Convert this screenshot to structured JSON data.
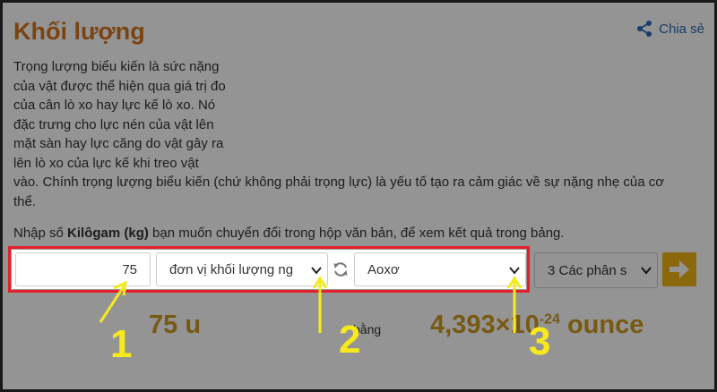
{
  "page": {
    "title": "Khối lượng",
    "share_label": "Chia sẻ",
    "description_lines": [
      "Trọng lượng biểu kiến là sức nặng",
      "của vật được thể hiện qua giá trị đo",
      "của cân lò xo hay lực kế lò xo. Nó",
      "đặc trưng cho lực nén của vật lên",
      "mặt sàn hay lực căng do vật gây ra",
      "lên lò xo của lực kế khi treo vật"
    ],
    "description_tail": "vào. Chính trọng lượng biểu kiến (chứ không phải trọng lực) là yếu tố tạo ra cảm giác về sự nặng nhẹ của cơ thể.",
    "instruction_prefix": "Nhập số ",
    "instruction_bold": "Kilôgam (kg)",
    "instruction_suffix": " bạn muốn chuyển đổi trong hộp văn bản, để xem kết quả trong bảng."
  },
  "converter": {
    "input_value": "75",
    "from_unit": "đơn vị khối lượng ng",
    "to_unit": "Aoxơ",
    "significant_figures": "3 Các phân s",
    "result_left": "75 u",
    "result_mid": "bằng",
    "result_right_prefix": "4,393×",
    "result_right_mid": "10",
    "result_right_exp": "-24",
    "result_right_unit": " ounce"
  },
  "annotations": {
    "marker_1": "1",
    "marker_2": "2",
    "marker_3": "3",
    "highlight_color": "#e5202b",
    "arrow_color": "#f6ea1e"
  },
  "colors": {
    "title": "#d4741f",
    "link": "#2a6ab5",
    "accent_button": "#f2b315",
    "result": "#cf9a24"
  }
}
